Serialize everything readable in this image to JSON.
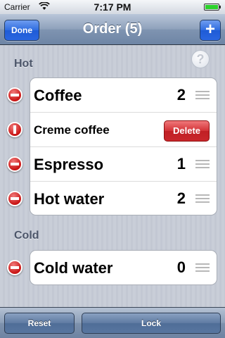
{
  "status_bar": {
    "carrier": "Carrier",
    "time": "7:17 PM"
  },
  "nav": {
    "title": "Order (5)",
    "done_label": "Done",
    "add_label": "+"
  },
  "help": {
    "label": "?"
  },
  "sections": [
    {
      "header": "Hot",
      "items": [
        {
          "name": "Coffee",
          "qty": "2"
        },
        {
          "name": "Creme coffee",
          "delete_label": "Delete"
        },
        {
          "name": "Espresso",
          "qty": "1"
        },
        {
          "name": "Hot water",
          "qty": "2"
        }
      ]
    },
    {
      "header": "Cold",
      "items": [
        {
          "name": "Cold water",
          "qty": "0"
        }
      ]
    }
  ],
  "toolbar": {
    "reset_label": "Reset",
    "lock_label": "Lock"
  },
  "colors": {
    "nav_tint": "#8ea1bb",
    "done_blue": "#2f6ce0",
    "delete_red": "#c9262b",
    "section_text": "#4c566a"
  },
  "icons": [
    "wifi-icon",
    "battery-icon",
    "help-icon",
    "delete-control-icon",
    "reorder-grip-icon"
  ]
}
